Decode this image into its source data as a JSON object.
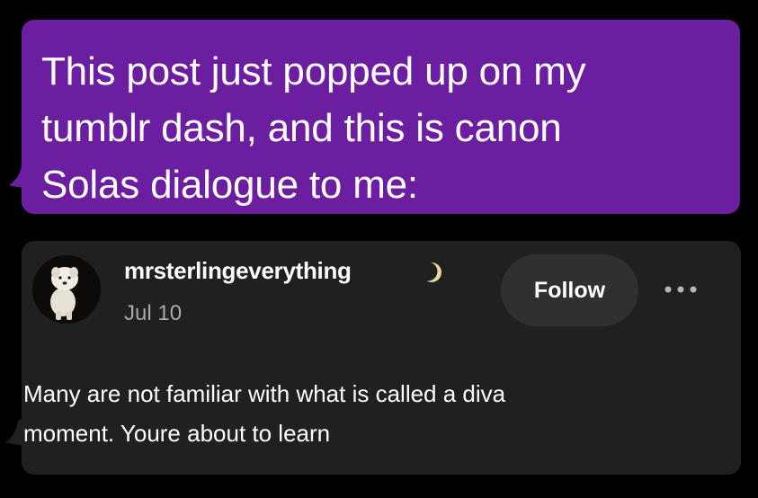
{
  "message": {
    "text": "This post just popped up on my\ntumblr dash, and this is canon\nSolas dialogue to me:",
    "bubble_color": "#6b1fa0"
  },
  "post": {
    "card_color": "#202020",
    "username": "mrsterlingeverything",
    "badge_icon": "crescent-moon-icon",
    "date": "Jul 10",
    "follow_label": "Follow",
    "more_icon": "ellipsis-icon",
    "body": "Many are not familiar with what is called a diva\nmoment. Youre about to learn"
  }
}
